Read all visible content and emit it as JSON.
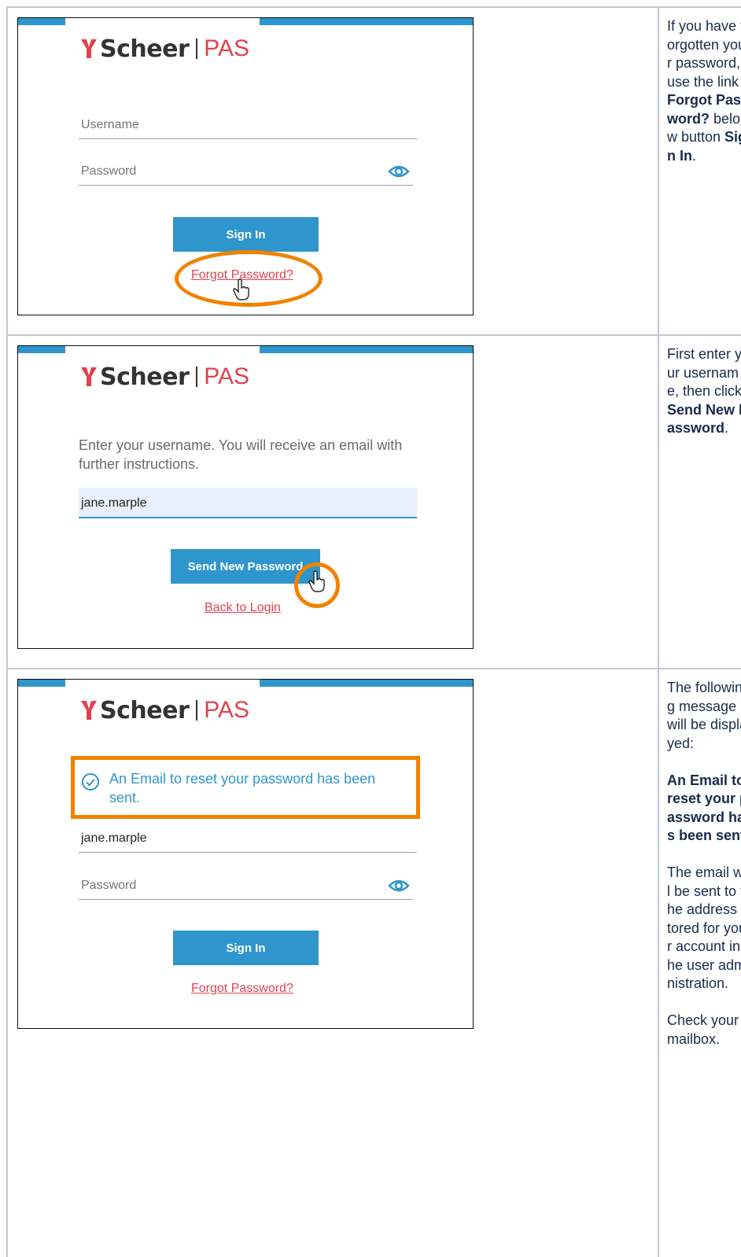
{
  "colors": {
    "accent": "#2e96cc",
    "brand_red": "#e0424f",
    "highlight": "#f08200"
  },
  "logo": {
    "brand": "Scheer",
    "product": "PAS"
  },
  "step1": {
    "username_placeholder": "Username",
    "password_placeholder": "Password",
    "sign_in": "Sign In",
    "forgot": "Forgot Password?",
    "desc_a": "If you have forgotten your password, use the link ",
    "desc_b": "Forgot Password?",
    "desc_c": " below button ",
    "desc_d": "Sign In",
    "desc_e": "."
  },
  "step2": {
    "instruction": "Enter your username. You will receive an email with further instructions.",
    "username_value": "jane.marple",
    "send_button": "Send New Password",
    "back_link": "Back to Login",
    "desc_a": "First enter your username, then click ",
    "desc_b": "Send New Password",
    "desc_c": "."
  },
  "step3": {
    "alert": "An Email to reset your password has been sent.",
    "username_value": "jane.marple",
    "password_placeholder": "Password",
    "sign_in": "Sign In",
    "forgot": "Forgot Password?",
    "desc_intro": "The following message will be displayed:",
    "desc_bold": "An Email to reset your password has been sent.",
    "desc_email": "The email will be sent to the address stored for your account in the user administration.",
    "desc_check": "Check your mailbox."
  }
}
